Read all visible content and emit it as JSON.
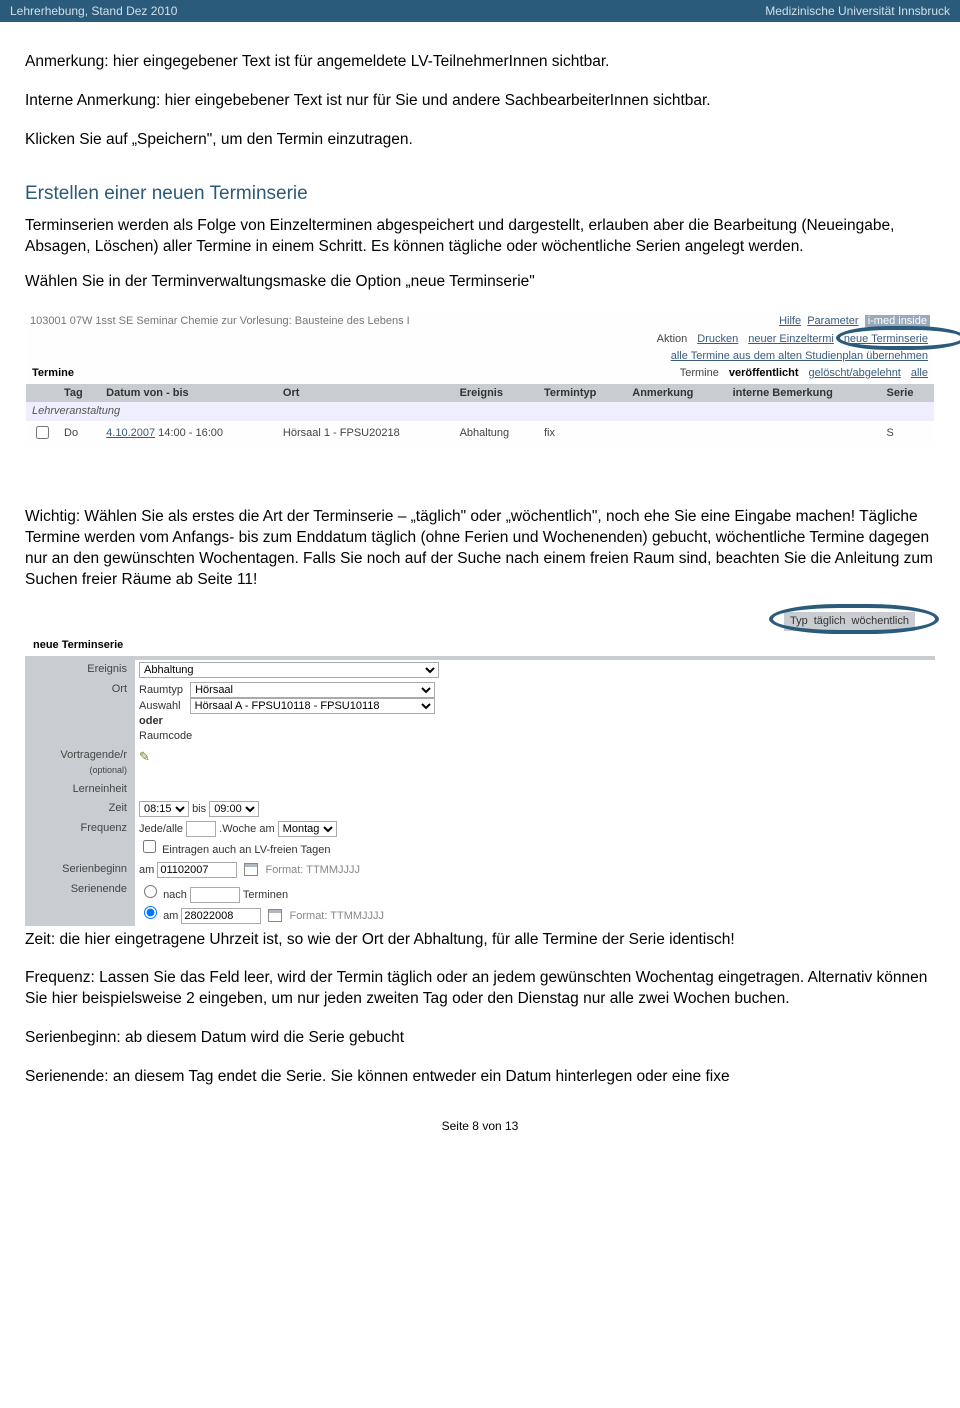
{
  "header": {
    "left": "Lehrerhebung, Stand Dez 2010",
    "right": "Medizinische Universität Innsbruck"
  },
  "para1": "Anmerkung: hier eingegebener Text ist für angemeldete LV-TeilnehmerInnen sichtbar.",
  "para2": "Interne Anmerkung: hier eingebebener Text ist nur für Sie und andere SachbearbeiterInnen sichtbar.",
  "para3": "Klicken Sie auf „Speichern\", um den Termin einzutragen.",
  "sec_h": "Erstellen einer neuen Terminserie",
  "sec_p1": "Terminserien werden als Folge von Einzelterminen abgespeichert und dargestellt, erlauben aber die Bearbeitung (Neueingabe, Absagen, Löschen) aller Termine in einem Schritt. Es können tägliche oder wöchentliche Serien angelegt werden.",
  "sec_p2": "Wählen Sie in der Terminverwaltungsmaske die Option „neue Terminserie\"",
  "ss1": {
    "course": "103001 07W 1sst SE Seminar Chemie zur Vorlesung: Bausteine des Lebens I",
    "hilfe": "Hilfe",
    "parameter": "Parameter",
    "imed": "i-med inside",
    "aktion": "Aktion",
    "drucken": "Drucken",
    "neuer_et": "neuer Einzeltermi",
    "neue_ts": "neue Terminserie",
    "alle_termine": "alle Termine aus dem alten Studienplan übernehmen",
    "termine_title": "Termine",
    "termine_lbl": "Termine",
    "veroeff": "veröffentlicht",
    "gel": "gelöscht/abgelehnt",
    "alle": "alle",
    "th_tag": "Tag",
    "th_datum": "Datum von  -  bis",
    "th_ort": "Ort",
    "th_ereignis": "Ereignis",
    "th_termintyp": "Termintyp",
    "th_anm": "Anmerkung",
    "th_int": "interne Bemerkung",
    "th_serie": "Serie",
    "lv": "Lehrveranstaltung",
    "row_tag": "Do",
    "row_datum": "4.10.2007",
    "row_zeit": "14:00 - 16:00",
    "row_ort": "Hörsaal 1 - FPSU20218",
    "row_ereignis": "Abhaltung",
    "row_typ": "fix",
    "row_serie": "S"
  },
  "mid_p": "Wichtig: Wählen Sie als erstes die Art der Terminserie – „täglich\" oder „wöchentlich\", noch ehe Sie eine Eingabe machen! Tägliche Termine werden vom Anfangs- bis zum Enddatum täglich (ohne Ferien und Wochenenden) gebucht, wöchentliche Termine dagegen nur an den gewünschten Wochentagen. Falls Sie noch auf der Suche nach einem freien Raum sind, beachten Sie die Anleitung zum Suchen freier Räume ab Seite 11!",
  "ss2": {
    "typ": "Typ",
    "taeglich": "täglich",
    "woechentlich": "wöchentlich",
    "title": "neue Terminserie",
    "lbl_ereignis": "Ereignis",
    "val_ereignis": "Abhaltung",
    "lbl_ort": "Ort",
    "raumtyp": "Raumtyp",
    "val_raumtyp": "Hörsaal",
    "auswahl": "Auswahl",
    "val_auswahl": "Hörsaal A - FPSU10118 - FPSU10118",
    "oder": "oder",
    "raumcode": "Raumcode",
    "lbl_vortr": "Vortragende/r",
    "lbl_vortr2": "(optional)",
    "lbl_lern": "Lerneinheit",
    "lbl_zeit": "Zeit",
    "val_zeit1": "08:15",
    "bis": "bis",
    "val_zeit2": "09:00",
    "lbl_freq": "Frequenz",
    "freq_jede": "Jede/alle",
    "freq_woche": ".Woche am",
    "val_montag": "Montag",
    "chk_lv": "Eintragen auch an LV-freien Tagen",
    "lbl_sbegin": "Serienbeginn",
    "am": "am",
    "val_sbegin": "01102007",
    "format": "Format: TTMMJJJJ",
    "lbl_sende": "Serienende",
    "nach": "nach",
    "terminen": "Terminen",
    "val_sende": "28022008"
  },
  "after_p1": "Zeit: die hier eingetragene Uhrzeit ist, so wie der Ort der Abhaltung, für alle Termine der Serie identisch!",
  "after_p2": "Frequenz: Lassen Sie das Feld leer, wird der Termin täglich oder an jedem gewünschten Wochentag eingetragen. Alternativ können Sie hier beispielsweise 2 eingeben, um nur jeden zweiten Tag oder den Dienstag nur alle zwei Wochen buchen.",
  "after_p3": "Serienbeginn: ab diesem Datum wird die Serie gebucht",
  "after_p4": "Serienende: an diesem Tag endet die Serie. Sie können entweder ein Datum hinterlegen oder eine fixe",
  "footer": "Seite 8 von 13"
}
